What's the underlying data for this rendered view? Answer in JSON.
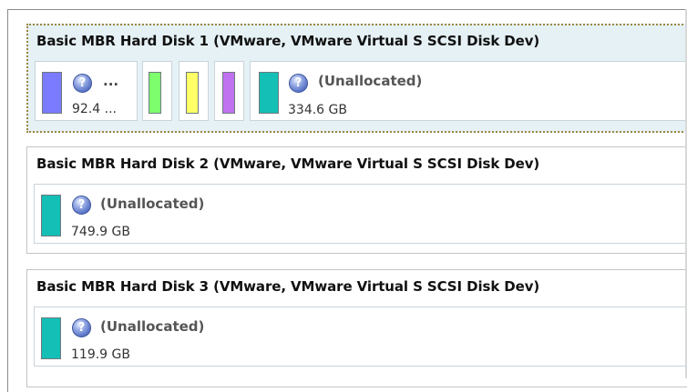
{
  "disks": [
    {
      "title": "Basic MBR Hard Disk 1 (VMware, VMware Virtual S SCSI Disk Dev)",
      "partitions": [
        {
          "label": "...",
          "size": "92.4 ...",
          "color": "#7b7bff"
        },
        {
          "label": "",
          "size": "",
          "color": "#7dff6d"
        },
        {
          "label": "",
          "size": "",
          "color": "#ffff66"
        },
        {
          "label": "",
          "size": "",
          "color": "#c071f0"
        },
        {
          "label": "(Unallocated)",
          "size": "334.6 GB",
          "color": "#14bfb5"
        }
      ]
    },
    {
      "title": "Basic MBR Hard Disk 2 (VMware, VMware Virtual S SCSI Disk Dev)",
      "partitions": [
        {
          "label": "(Unallocated)",
          "size": "749.9 GB",
          "color": "#14bfb5"
        }
      ]
    },
    {
      "title": "Basic MBR Hard Disk 3 (VMware, VMware Virtual S SCSI Disk Dev)",
      "partitions": [
        {
          "label": "(Unallocated)",
          "size": "119.9 GB",
          "color": "#14bfb5"
        }
      ]
    }
  ],
  "icons": {
    "unknown_fs": "question-mark-icon"
  }
}
